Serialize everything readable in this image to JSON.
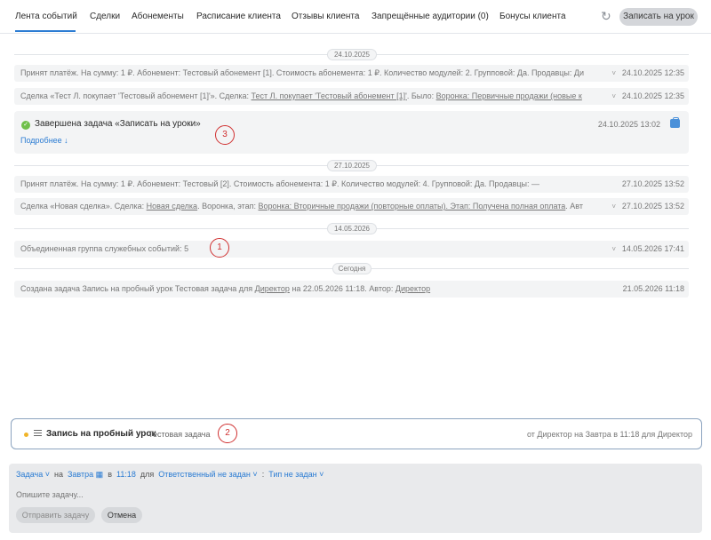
{
  "tabs": [
    {
      "label": "Лента событий",
      "active": true
    },
    {
      "label": "Сделки"
    },
    {
      "label": "Абонементы"
    },
    {
      "label": "Расписание клиента"
    },
    {
      "label": "Отзывы клиента"
    },
    {
      "label": "Запрещённые аудитории (0)"
    },
    {
      "label": "Бонусы клиента"
    }
  ],
  "toolbar": {
    "refresh_icon": "refresh-icon",
    "book_lesson_label": "Записать на урок"
  },
  "separators": [
    "24.10.2025",
    "27.10.2025",
    "14.05.2026",
    "Сегодня"
  ],
  "events": {
    "e1": {
      "text": "Принят платёж. На сумму: 1 ₽. Абонемент: Тестовый абонемент [1]. Стоимость абонемента: 1 ₽. Количество модулей: 2. Групповой: Да. Продавцы: Ди",
      "time": "24.10.2025 12:35"
    },
    "e2": {
      "prefix": "Сделка «Тест Л. покупает 'Тестовый абонемент [1]'». Сделка: ",
      "link1": "Тест Л. покупает 'Тестовый абонемент [1]'",
      "mid": ". Было: ",
      "link2": "Воронка: Первичные продажи (новые к",
      "time": "24.10.2025 12:35"
    },
    "task": {
      "title": "Завершена задача «Записать на уроки»",
      "more": "Подробнее ↓",
      "time": "24.10.2025 13:02"
    },
    "e3": {
      "text": "Принят платёж. На сумму: 1 ₽. Абонемент: Тестовый [2]. Стоимость абонемента: 1 ₽. Количество модулей: 4. Групповой: Да. Продавцы: —",
      "time": "27.10.2025 13:52"
    },
    "e4": {
      "prefix": "Сделка «Новая сделка». Сделка: ",
      "link1": "Новая сделка",
      "mid1": ". Воронка, этап: ",
      "link2": "Воронка: Вторичные продажи (повторные оплаты). Этап: Получена полная оплата",
      "suffix": ". Авт",
      "time": "27.10.2025 13:52"
    },
    "e5": {
      "text": "Объединенная группа служебных событий: 5",
      "time": "14.05.2026 17:41"
    },
    "e6": {
      "prefix": "Создана задача Запись на пробный урок Тестовая задача для ",
      "link1": "Директор",
      "mid": " на 22.05.2026 11:18. Автор: ",
      "link2": "Директор",
      "time": "21.05.2026 11:18"
    }
  },
  "markers": [
    "1",
    "2",
    "3"
  ],
  "pending": {
    "title": "Запись на пробный урок",
    "desc": "Тестовая задача",
    "meta": "от Директор на Завтра в 11:18 для Директор"
  },
  "composer": {
    "type": "Задача",
    "on": "на",
    "day": "Завтра",
    "at": "в",
    "time": "11:18",
    "for": "для",
    "assignee": "Ответственный не задан",
    "colon": ":",
    "kind": "Тип не задан",
    "placeholder": "Опишите задачу...",
    "send": "Отправить задачу",
    "cancel": "Отмена"
  },
  "colors": {
    "accent": "#2b7cd3",
    "marker": "#d03030",
    "done": "#6fbf4a",
    "pending_dot": "#f0b429"
  }
}
